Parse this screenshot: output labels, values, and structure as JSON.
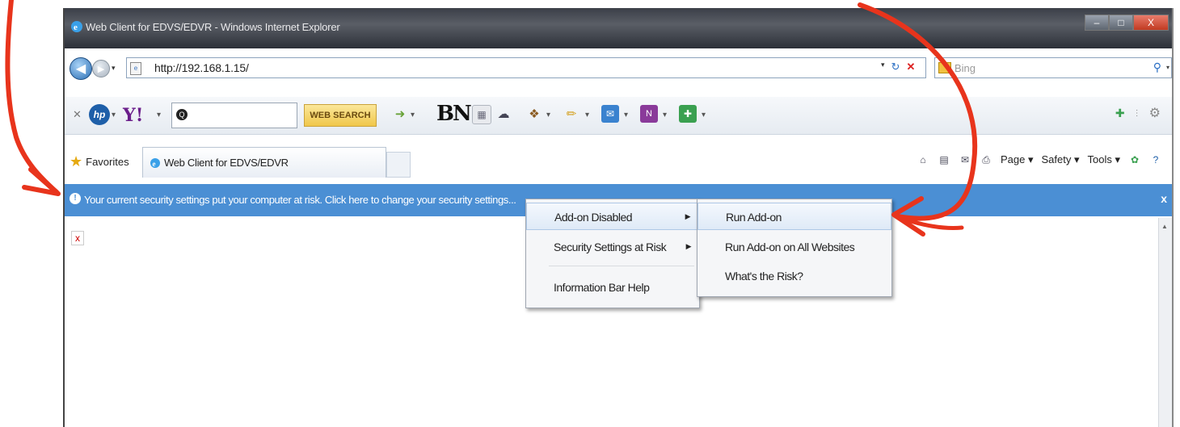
{
  "window": {
    "title": "Web Client for EDVS/EDVR - Windows Internet Explorer",
    "controls": {
      "minimize": "–",
      "maximize": "□",
      "close": "X"
    }
  },
  "address_bar": {
    "url": "http://192.168.1.15/",
    "search_placeholder": "Bing"
  },
  "toolbar": {
    "search_button_label": "WEB SEARCH",
    "bn_label": "BN"
  },
  "favorites": {
    "label": "Favorites"
  },
  "tab": {
    "label": "Web Client for EDVS/EDVR"
  },
  "command_bar": {
    "page_label": "Page ▾",
    "safety_label": "Safety ▾",
    "tools_label": "Tools ▾"
  },
  "info_bar": {
    "message": "Your current security settings put your computer at risk. Click here to change your security settings...",
    "close": "x"
  },
  "content": {
    "broken_image": "x"
  },
  "context_menu": {
    "items": [
      {
        "label": "Add-on Disabled"
      },
      {
        "label": "Security Settings at Risk"
      },
      {
        "label": "Information Bar Help"
      }
    ]
  },
  "submenu": {
    "items": [
      {
        "label": "Run Add-on"
      },
      {
        "label": "Run Add-on on All Websites"
      },
      {
        "label": "What's the Risk?"
      }
    ]
  },
  "colors": {
    "info_bar": "#4b8fd4",
    "annotation": "#e8341c",
    "titlebar": "#3b3f48"
  }
}
